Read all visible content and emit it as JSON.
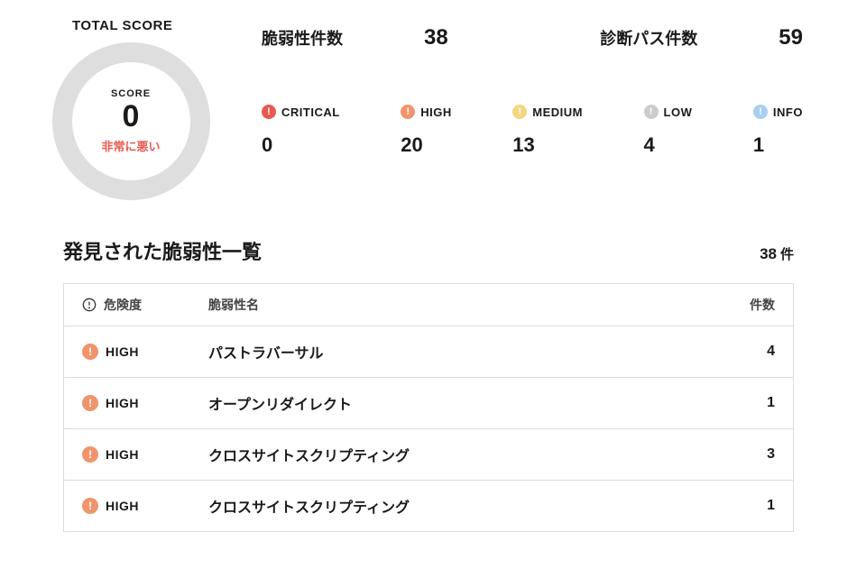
{
  "score_panel": {
    "total_score_label": "TOTAL SCORE",
    "gauge_label": "SCORE",
    "gauge_value": "0",
    "gauge_status": "非常に悪い"
  },
  "top_stats": {
    "vuln_count_label": "脆弱性件数",
    "vuln_count_value": "38",
    "path_count_label": "診断パス件数",
    "path_count_value": "59"
  },
  "severities": [
    {
      "key": "critical",
      "label": "CRITICAL",
      "count": "0"
    },
    {
      "key": "high",
      "label": "HIGH",
      "count": "20"
    },
    {
      "key": "medium",
      "label": "MEDIUM",
      "count": "13"
    },
    {
      "key": "low",
      "label": "LOW",
      "count": "4"
    },
    {
      "key": "info",
      "label": "INFO",
      "count": "1"
    }
  ],
  "list": {
    "title": "発見された脆弱性一覧",
    "count": "38",
    "count_unit": "件",
    "columns": {
      "severity": "危険度",
      "name": "脆弱性名",
      "count": "件数"
    },
    "rows": [
      {
        "severity_key": "high",
        "severity_label": "HIGH",
        "name": "パストラバーサル",
        "count": "4"
      },
      {
        "severity_key": "high",
        "severity_label": "HIGH",
        "name": "オープンリダイレクト",
        "count": "1"
      },
      {
        "severity_key": "high",
        "severity_label": "HIGH",
        "name": "クロスサイトスクリプティング",
        "count": "3"
      },
      {
        "severity_key": "high",
        "severity_label": "HIGH",
        "name": "クロスサイトスクリプティング",
        "count": "1"
      }
    ]
  }
}
